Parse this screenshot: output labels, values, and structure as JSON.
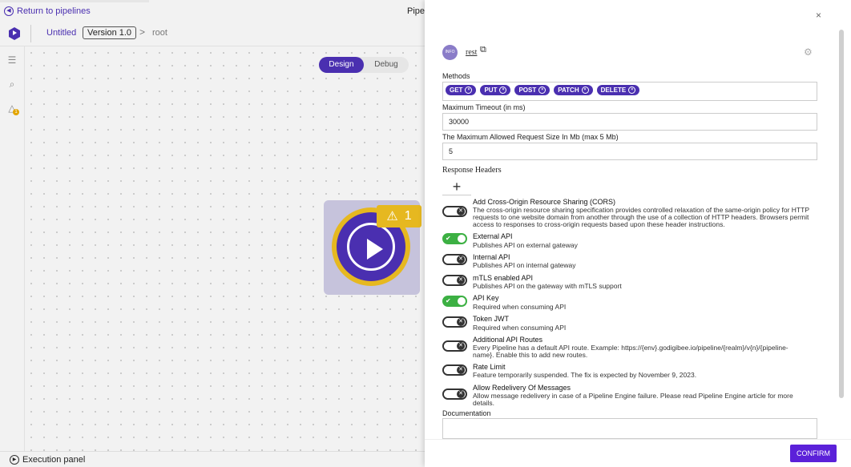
{
  "topbar": {
    "back_label": "Return to pipelines",
    "pipeline_name": "Pipe"
  },
  "header": {
    "untitled": "Untitled",
    "version": "Version 1.0",
    "chevron": ">",
    "root": "root"
  },
  "canvas": {
    "mode_design": "Design",
    "mode_debug": "Debug",
    "node_warning_count": "1"
  },
  "rail": {
    "warning_badge": "1"
  },
  "execution_panel": {
    "label": "Execution panel"
  },
  "drawer": {
    "avatar_text": "INFO",
    "endpoint_link": "rest",
    "methods_label": "Methods",
    "methods": [
      "GET",
      "PUT",
      "POST",
      "PATCH",
      "DELETE"
    ],
    "timeout_label": "Maximum Timeout (in ms)",
    "timeout_value": "30000",
    "size_label": "The Maximum Allowed Request Size In Mb (max 5 Mb)",
    "size_value": "5",
    "response_headers_label": "Response Headers",
    "add_symbol": "+",
    "options": [
      {
        "title": "Add Cross-Origin Resource Sharing (CORS)",
        "desc": "The cross-origin resource sharing specification provides controlled relaxation of the same-origin policy for HTTP requests to one website domain from another through the use of a collection of HTTP headers. Browsers permit access to responses to cross-origin requests based upon these header instructions.",
        "on": false
      },
      {
        "title": "External API",
        "desc": "Publishes API on external gateway",
        "on": true
      },
      {
        "title": "Internal API",
        "desc": "Publishes API on internal gateway",
        "on": false
      },
      {
        "title": "mTLS enabled API",
        "desc": "Publishes API on the gateway with mTLS support",
        "on": false
      },
      {
        "title": "API Key",
        "desc": "Required when consuming API",
        "on": true
      },
      {
        "title": "Token JWT",
        "desc": "Required when consuming API",
        "on": false
      },
      {
        "title": "Additional API Routes",
        "desc": "Every Pipeline has a default API route. Example: https://{env}.godigibee.io/pipeline/{realm}/v{n}/{pipeline-name}. Enable this to add new routes.",
        "on": false
      },
      {
        "title": "Rate Limit",
        "desc": "Feature temporarily suspended. The fix is expected by November 9, 2023.",
        "on": false
      },
      {
        "title": "Allow Redelivery Of Messages",
        "desc": "Allow message redelivery in case of a Pipeline Engine failure. Please read Pipeline Engine article for more details.",
        "on": false
      }
    ],
    "documentation_label": "Documentation",
    "confirm_label": "CONFIRM",
    "close_symbol": "×"
  },
  "colors": {
    "accent": "#4a2fb0",
    "confirm": "#5b21d9",
    "toggle_on": "#3cb043",
    "warning": "#e6b820"
  }
}
